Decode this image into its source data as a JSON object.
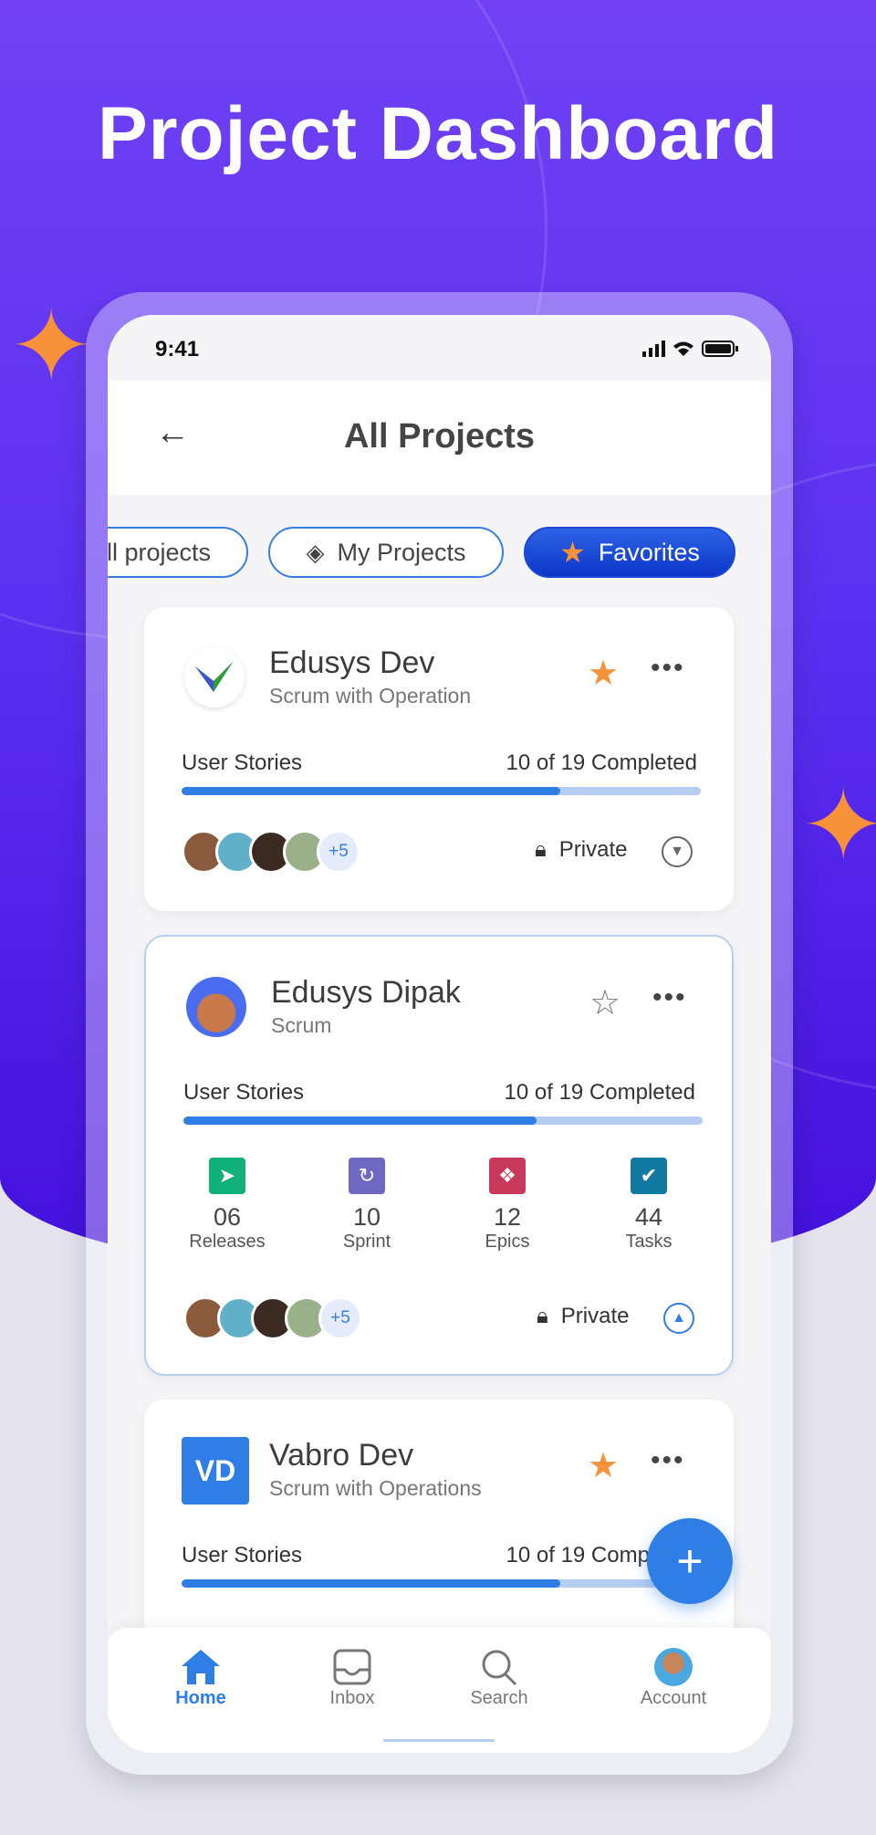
{
  "title": "Project Dashboard",
  "status_bar": {
    "time": "9:41"
  },
  "header": {
    "title": "All Projects"
  },
  "chips": [
    {
      "label": "All projects"
    },
    {
      "label": "My Projects",
      "icon": "layers-icon"
    },
    {
      "label": "Favorites",
      "icon": "star-icon",
      "active": true
    }
  ],
  "projects": [
    {
      "name": "Edusys Dev",
      "type": "Scrum with Operation",
      "favorite": true,
      "progress_label": "User Stories",
      "progress_text": "10 of 19 Completed",
      "progress_percent": 73,
      "extra_members": "+5",
      "visibility": "Private",
      "expanded": false
    },
    {
      "name": "Edusys Dipak",
      "type": "Scrum",
      "favorite": false,
      "progress_label": "User Stories",
      "progress_text": "10 of 19 Completed",
      "progress_percent": 68,
      "extra_members": "+5",
      "visibility": "Private",
      "expanded": true,
      "stats": [
        {
          "value": "06",
          "label": "Releases",
          "color": "#12b07a"
        },
        {
          "value": "10",
          "label": "Sprint",
          "color": "#6d68c2"
        },
        {
          "value": "12",
          "label": "Epics",
          "color": "#c7385a"
        },
        {
          "value": "44",
          "label": "Tasks",
          "color": "#127aa0"
        }
      ]
    },
    {
      "name": "Vabro Dev",
      "initials": "VD",
      "type": "Scrum with Operations",
      "favorite": true,
      "progress_label": "User Stories",
      "progress_text": "10 of 19 Completed",
      "progress_percent": 73
    }
  ],
  "nav": [
    {
      "label": "Home",
      "active": true
    },
    {
      "label": "Inbox"
    },
    {
      "label": "Search"
    },
    {
      "label": "Account"
    }
  ],
  "colors": {
    "accent": "#2f7ee6",
    "star": "#f7923a",
    "bg": "#5a2ff0"
  }
}
